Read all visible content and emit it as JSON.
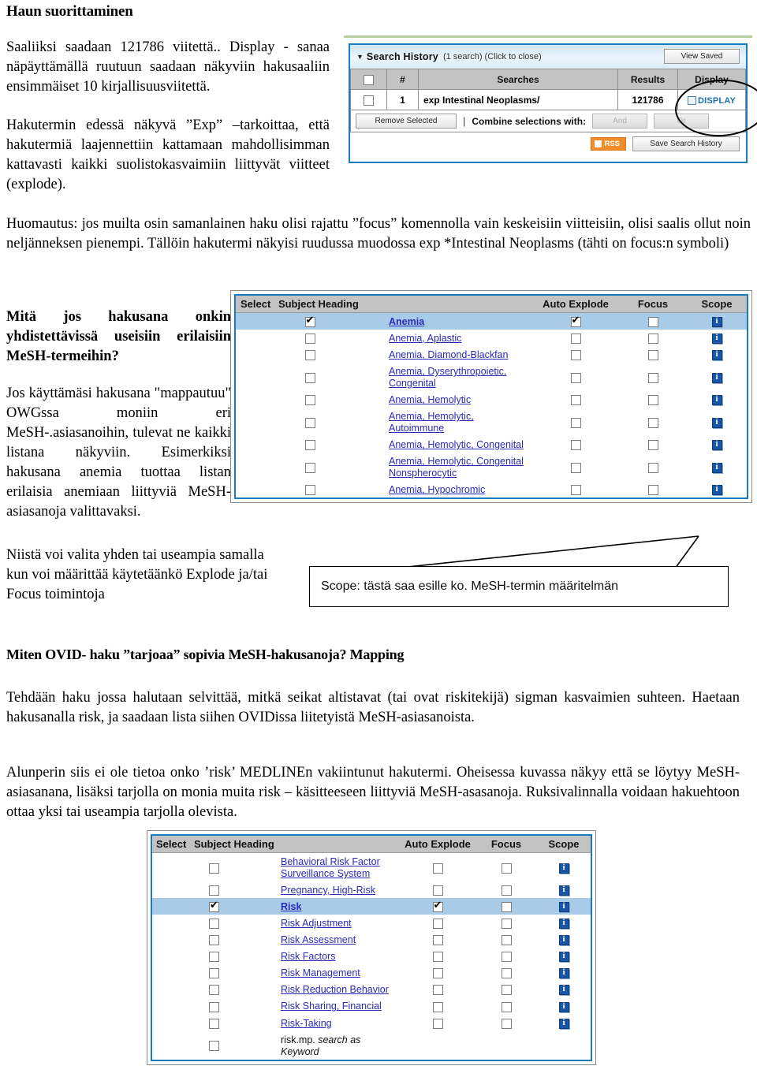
{
  "page": {
    "heading": "Haun suorittaminen",
    "para1": "Saaliiksi saadaan 121786 viitettä.. Display - sanaa näpäyttämällä ruutuun saadaan näkyviin hakusaaliin ensimmäiset 10 kirjallisuusviitettä.",
    "para2": "Hakutermin edessä näkyvä ”Exp” –tarkoittaa, että hakutermiä laajennettiin kattamaan mahdollisimman kattavasti kaikki suolistokasvaimiin liittyvät viitteet (explode).",
    "note": "Huomautus: jos muilta osin samanlainen haku olisi rajattu ”focus” komennolla vain keskeisiin viitteisiin, olisi saalis ollut noin neljänneksen pienempi. Tällöin hakutermi näkyisi ruudussa muodossa exp *Intestinal Neoplasms (tähti on focus:n symboli)",
    "q_heading": "Mitä jos hakusana onkin yhdistettävissä useisiin erilaisiin MeSH-termeihin?",
    "q_body": "Jos käyttämäsi hakusana \"mappautuu\" OWGssa moniin eri MeSH-.asiasanoihin, tulevat ne kaikki listana näkyviin. Esimerkiksi hakusana anemia tuottaa  listan erilaisia anemiaan liittyviä MeSH-asiasanoja valittavaksi.",
    "q_body2": "Niistä voi valita yhden tai useampia samalla kun voi määrittää käytetäänkö Explode ja/tai Focus toimintoja",
    "callout_scope": "Scope: tästä saa esille ko. MeSH-termin määritelmän",
    "h2_mapping": "Miten OVID- haku ”tarjoaa” sopivia MeSH-hakusanoja?  Mapping",
    "para3": "Tehdään haku jossa halutaan selvittää, mitkä seikat altistavat (tai ovat riskitekijä) sigman kasvaimien suhteen. Haetaan hakusanalla risk,  ja saadaan lista siihen OVIDissa liitetyistä MeSH-asiasanoista.",
    "para4": "Alunperin siis ei ole tietoa onko ’risk’  MEDLINEn vakiintunut hakutermi. Oheisessa kuvassa näkyy että se löytyy MeSH-asiasanana, lisäksi tarjolla on monia muita risk – käsitteeseen liittyviä MeSH-asasanoja. Ruksivalinnalla voidaan hakuehtoon ottaa yksi tai useampia tarjolla olevista."
  },
  "search_history": {
    "caret": "▼",
    "title": "Search History",
    "subtitle": "(1 search) (Click to close)",
    "view_saved_label": "View Saved",
    "columns": [
      "",
      "#",
      "Searches",
      "Results",
      "Display"
    ],
    "row": {
      "selected": false,
      "number": "1",
      "query": "exp Intestinal Neoplasms/",
      "results": "121786",
      "display_label": "DISPLAY",
      "display_icon": "display-arrow-icon"
    },
    "remove_selected_label": "Remove Selected",
    "combine_label": "Combine selections with:",
    "and_label": "And",
    "or_label": "Or",
    "rss_label": "RSS",
    "save_label": "Save Search History"
  },
  "mesh_anemia": {
    "columns": [
      "Select",
      "Subject Heading",
      "Auto Explode",
      "Focus",
      "Scope"
    ],
    "scope_icon": "info-icon",
    "rows": [
      {
        "term": "Anemia",
        "select": true,
        "explode": true,
        "focus": false,
        "highlight": true
      },
      {
        "term": "Anemia, Aplastic",
        "select": false,
        "explode": false,
        "focus": false,
        "highlight": false
      },
      {
        "term": "Anemia, Diamond-Blackfan",
        "select": false,
        "explode": false,
        "focus": false,
        "highlight": false
      },
      {
        "term": "Anemia, Dyserythropoietic, Congenital",
        "select": false,
        "explode": false,
        "focus": false,
        "highlight": false
      },
      {
        "term": "Anemia, Hemolytic",
        "select": false,
        "explode": false,
        "focus": false,
        "highlight": false
      },
      {
        "term": "Anemia, Hemolytic, Autoimmune",
        "select": false,
        "explode": false,
        "focus": false,
        "highlight": false
      },
      {
        "term": "Anemia, Hemolytic, Congenital",
        "select": false,
        "explode": false,
        "focus": false,
        "highlight": false
      },
      {
        "term": "Anemia, Hemolytic, Congenital Nonspherocytic",
        "select": false,
        "explode": false,
        "focus": false,
        "highlight": false
      },
      {
        "term": "Anemia, Hypochromic",
        "select": false,
        "explode": false,
        "focus": false,
        "highlight": false
      }
    ]
  },
  "mesh_risk": {
    "columns": [
      "Select",
      "Subject Heading",
      "Auto Explode",
      "Focus",
      "Scope"
    ],
    "scope_icon": "info-icon",
    "rows": [
      {
        "term": "Behavioral Risk Factor Surveillance System",
        "select": false,
        "explode": false,
        "focus": false,
        "highlight": false,
        "scope": true
      },
      {
        "term": "Pregnancy, High-Risk",
        "select": false,
        "explode": false,
        "focus": false,
        "highlight": false,
        "scope": true
      },
      {
        "term": "Risk",
        "select": true,
        "explode": true,
        "focus": false,
        "highlight": true,
        "scope": true
      },
      {
        "term": "Risk Adjustment",
        "select": false,
        "explode": false,
        "focus": false,
        "highlight": false,
        "scope": true
      },
      {
        "term": "Risk Assessment",
        "select": false,
        "explode": false,
        "focus": false,
        "highlight": false,
        "scope": true
      },
      {
        "term": "Risk Factors",
        "select": false,
        "explode": false,
        "focus": false,
        "highlight": false,
        "scope": true
      },
      {
        "term": "Risk Management",
        "select": false,
        "explode": false,
        "focus": false,
        "highlight": false,
        "scope": true
      },
      {
        "term": "Risk Reduction Behavior",
        "select": false,
        "explode": false,
        "focus": false,
        "highlight": false,
        "scope": true
      },
      {
        "term": "Risk Sharing, Financial",
        "select": false,
        "explode": false,
        "focus": false,
        "highlight": false,
        "scope": true
      },
      {
        "term": "Risk-Taking",
        "select": false,
        "explode": false,
        "focus": false,
        "highlight": false,
        "scope": true
      },
      {
        "term": "risk.mp. search as Keyword",
        "select": false,
        "explode": null,
        "focus": null,
        "highlight": false,
        "scope": false,
        "keyword": true
      }
    ]
  },
  "colors": {
    "link": "#2a2ab8",
    "header_gray": "#c3c3c3",
    "selected_row": "#a8cbe8",
    "panel_border": "#1a7bbd",
    "rss_orange": "#f28c28",
    "display_link": "#1a6fa8"
  }
}
